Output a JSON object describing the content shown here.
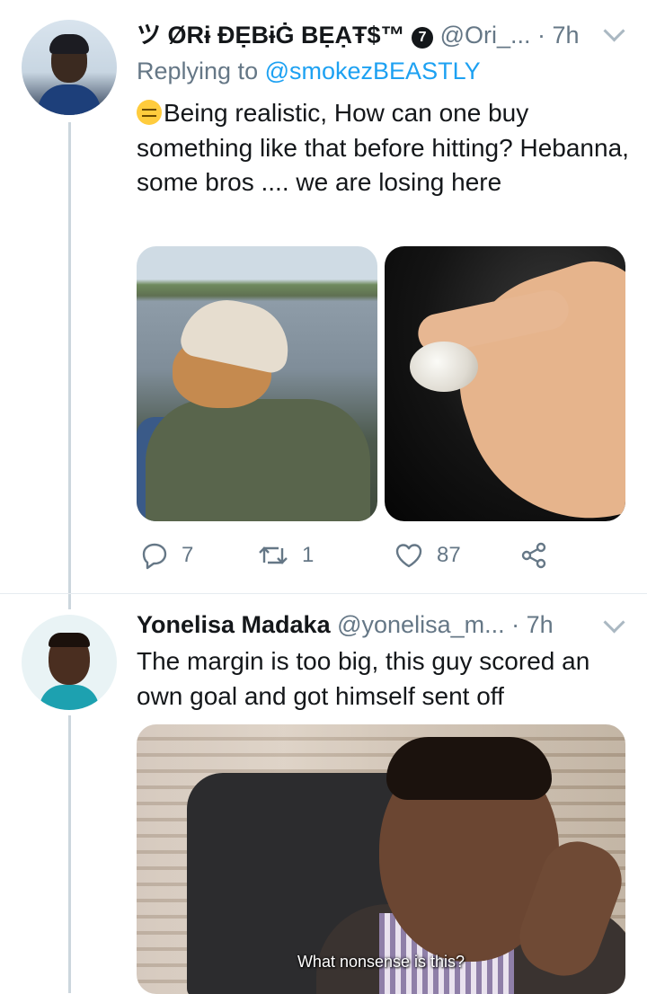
{
  "tweets": [
    {
      "display_name": "ツ ØRɨ ĐẸBɨĠ BẸẠŦ$™",
      "badge": "7",
      "handle": "@Ori_...",
      "dot": "·",
      "time": "7h",
      "replying_label": "Replying to",
      "replying_to": "@smokezBEASTLY",
      "text": "Being realistic, How can one buy something like that before hitting? Hebanna, some bros .... we are losing here",
      "actions": {
        "replies": "7",
        "retweets": "1",
        "likes": "87"
      }
    },
    {
      "display_name": "Yonelisa Madaka",
      "handle": "@yonelisa_m...",
      "dot": "·",
      "time": "7h",
      "text": "The margin is too big, this guy scored an own goal and got himself sent off",
      "media_caption": "What nonsense is this?"
    }
  ],
  "icons": {
    "emoji": "expressionless-face-icon",
    "reply": "reply-icon",
    "retweet": "retweet-icon",
    "like": "heart-icon",
    "share": "share-icon",
    "menu": "chevron-down-icon"
  },
  "colors": {
    "link": "#1da1f2",
    "muted": "#657786",
    "text": "#14171a",
    "thread": "#ccd6dd"
  }
}
